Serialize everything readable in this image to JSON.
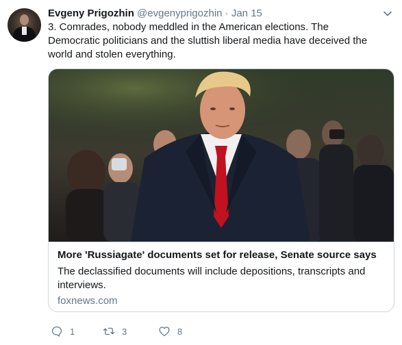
{
  "tweet": {
    "display_name": "Evgeny Prigozhin",
    "handle": "@evgenyprigozhin",
    "separator": "·",
    "date": "Jan 15",
    "text": "3. Comrades, nobody meddled in the American elections. The Democratic politicians and the sluttish liberal media have deceived the world and stolen everything."
  },
  "card": {
    "title": "More 'Russiagate' documents set for release, Senate source says",
    "description": "The declassified documents will include depositions, transcripts and interviews.",
    "domain": "foxnews.com"
  },
  "actions": {
    "reply_count": "1",
    "retweet_count": "3",
    "like_count": "8"
  },
  "icons": {
    "menu": "chevron-down-icon",
    "reply": "reply-icon",
    "retweet": "retweet-icon",
    "like": "heart-icon"
  },
  "colors": {
    "text": "#14171a",
    "secondary": "#657786",
    "border": "#ccd6dd"
  }
}
